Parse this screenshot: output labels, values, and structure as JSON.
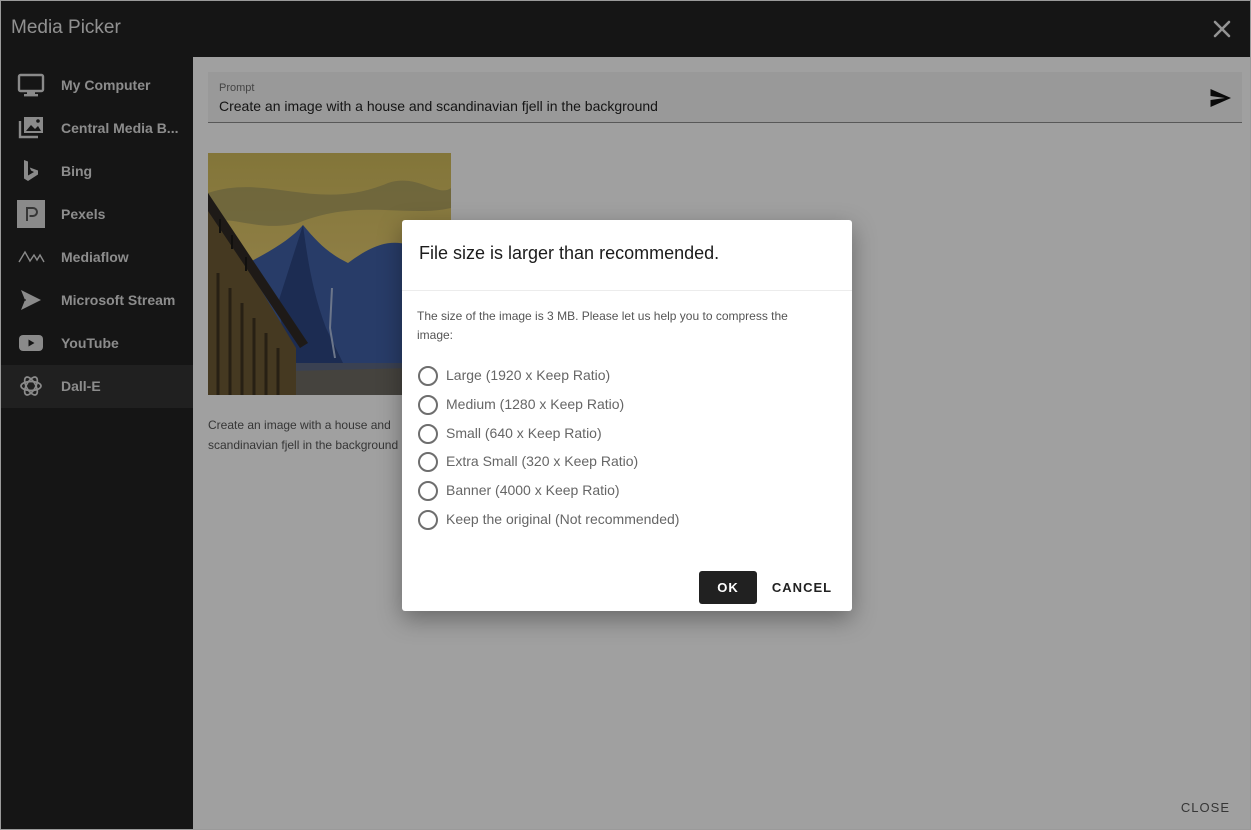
{
  "window": {
    "title": "Media Picker"
  },
  "sidebar": {
    "items": [
      {
        "label": "My Computer",
        "icon": "monitor-icon"
      },
      {
        "label": "Central Media B...",
        "icon": "image-stack-icon"
      },
      {
        "label": "Bing",
        "icon": "bing-icon"
      },
      {
        "label": "Pexels",
        "icon": "pexels-icon"
      },
      {
        "label": "Mediaflow",
        "icon": "mediaflow-icon"
      },
      {
        "label": "Microsoft Stream",
        "icon": "stream-icon"
      },
      {
        "label": "YouTube",
        "icon": "youtube-icon"
      },
      {
        "label": "Dall-E",
        "icon": "openai-icon"
      }
    ],
    "active_item": "Dall-E"
  },
  "prompt": {
    "label": "Prompt",
    "value": "Create an image with a house and scandinavian fjell in the background"
  },
  "result": {
    "caption": "Create an image with a house and scandinavian fjell in the background"
  },
  "footer": {
    "close_label": "CLOSE"
  },
  "dialog": {
    "title": "File size is larger than recommended.",
    "message": "The size of the image is 3 MB. Please let us help you to compress the image:",
    "options": [
      "Large (1920 x Keep Ratio)",
      "Medium (1280 x Keep Ratio)",
      "Small (640 x Keep Ratio)",
      "Extra Small (320 x Keep Ratio)",
      "Banner (4000 x Keep Ratio)",
      "Keep the original (Not recommended)"
    ],
    "ok_label": "OK",
    "cancel_label": "CANCEL"
  },
  "colors": {
    "chrome": "#212121",
    "sidebar_active": "#333333",
    "ok_button": "#212121"
  }
}
